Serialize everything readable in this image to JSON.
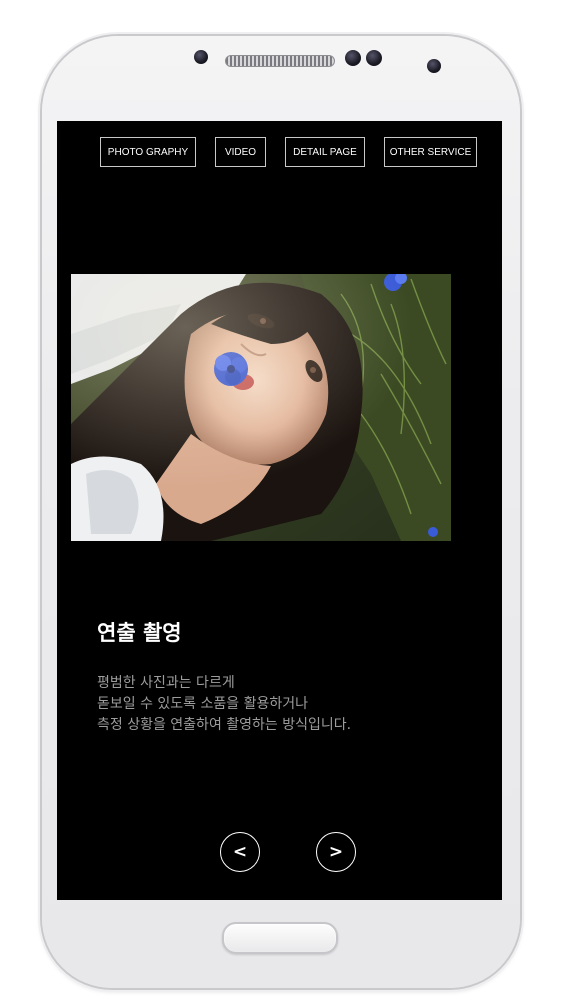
{
  "nav": {
    "items": [
      {
        "label": "PHOTO GRAPHY"
      },
      {
        "label": "VIDEO"
      },
      {
        "label": "DETAIL PAGE"
      },
      {
        "label": "OTHER SERVICE"
      }
    ]
  },
  "caption": {
    "title": "연출 촬영",
    "lines": [
      "평범한 사진과는 다르게",
      "돋보일 수 있도록 소품을 활용하거나",
      "측정 상황을 연출하여 촬영하는 방식입니다."
    ]
  },
  "pager": {
    "prev_label": "<",
    "next_label": ">"
  },
  "icons": {
    "prev": "chevron-left-icon",
    "next": "chevron-right-icon"
  },
  "colors": {
    "screen_bg": "#000000",
    "body_text": "#9c9c9c",
    "title_text": "#ffffff"
  }
}
